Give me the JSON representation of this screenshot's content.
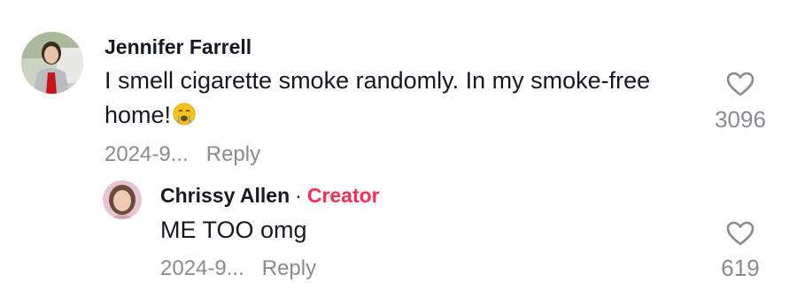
{
  "comment": {
    "username": "Jennifer Farrell",
    "text_line1": "I smell cigarette smoke randomly. In my smoke-free",
    "text_line2": "home!",
    "emoji": "crying-face-emoji",
    "date": "2024-9...",
    "reply_label": "Reply",
    "like_count": "3096"
  },
  "reply": {
    "username": "Chrissy Allen",
    "separator": "·",
    "badge": "Creator",
    "text": "ME TOO omg",
    "date": "2024-9...",
    "reply_label": "Reply",
    "like_count": "619"
  },
  "colors": {
    "text": "#161823",
    "muted": "#8a8b91",
    "creator": "#fe2c55"
  }
}
